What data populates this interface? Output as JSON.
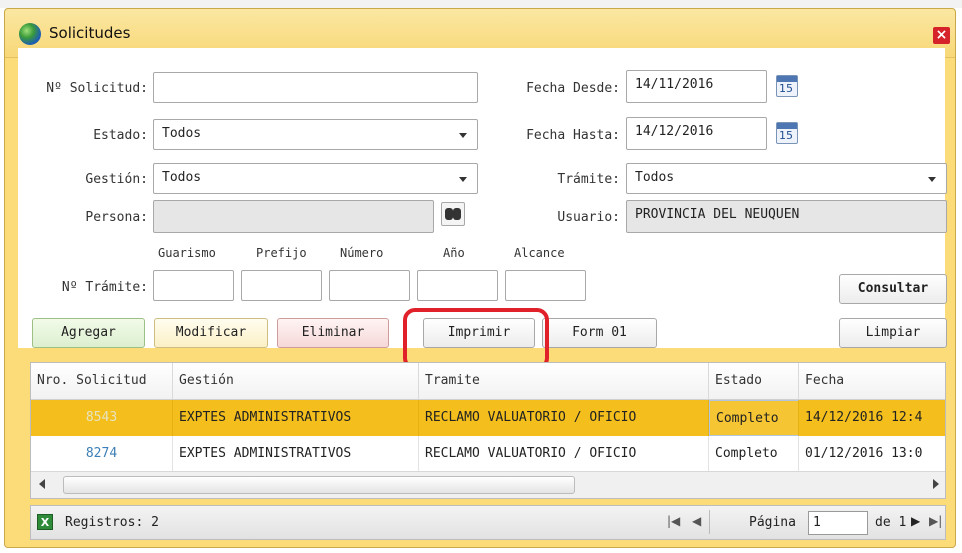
{
  "window": {
    "title": "Solicitudes",
    "close_symbol": "×"
  },
  "form": {
    "nro_solicitud_label": "Nº Solicitud:",
    "nro_solicitud_value": "",
    "fecha_desde_label": "Fecha Desde:",
    "fecha_desde_value": "14/11/2016",
    "fecha_hasta_label": "Fecha Hasta:",
    "fecha_hasta_value": "14/12/2016",
    "estado_label": "Estado:",
    "estado_value": "Todos",
    "gestion_label": "Gestión:",
    "gestion_value": "Todos",
    "tramite_label": "Trámite:",
    "tramite_value": "Todos",
    "persona_label": "Persona:",
    "persona_value": "",
    "usuario_label": "Usuario:",
    "usuario_value": "PROVINCIA DEL NEUQUEN",
    "calendar_day": "15",
    "nro_tramite_label": "Nº Trámite:",
    "tramite_parts": [
      "Guarismo",
      "Prefijo",
      "Número",
      "Año",
      "Alcance"
    ]
  },
  "buttons": {
    "consultar": "Consultar",
    "agregar": "Agregar",
    "modificar": "Modificar",
    "eliminar": "Eliminar",
    "imprimir": "Imprimir",
    "form01": "Form 01",
    "limpiar": "Limpiar"
  },
  "table": {
    "columns": [
      "Nro. Solicitud",
      "Gestión",
      "Tramite",
      "Estado",
      "Fecha"
    ],
    "rows": [
      {
        "nro": "8543",
        "gestion": "EXPTES ADMINISTRATIVOS",
        "tramite": "RECLAMO VALUATORIO / OFICIO",
        "estado": "Completo",
        "fecha": "14/12/2016 12:4",
        "selected": true
      },
      {
        "nro": "8274",
        "gestion": "EXPTES ADMINISTRATIVOS",
        "tramite": "RECLAMO VALUATORIO / OFICIO",
        "estado": "Completo",
        "fecha": "01/12/2016 13:0",
        "selected": false
      }
    ]
  },
  "footer": {
    "registros": "Registros: 2",
    "pagina_label": "Página",
    "pagina_value": "1",
    "de_label": "de 1"
  },
  "icons": {
    "title": "globe-icon",
    "close": "close-icon",
    "calendar": "calendar-icon",
    "search": "binoculars-icon",
    "excel": "excel-icon",
    "nav_first": "first-page-icon",
    "nav_prev": "prev-page-icon",
    "nav_next": "next-page-icon",
    "nav_last": "last-page-icon"
  },
  "colors": {
    "window_bg": "#fcdc78",
    "selected_row": "#f4bf1c",
    "highlight": "#e0212a",
    "close_button": "#d6232a"
  }
}
